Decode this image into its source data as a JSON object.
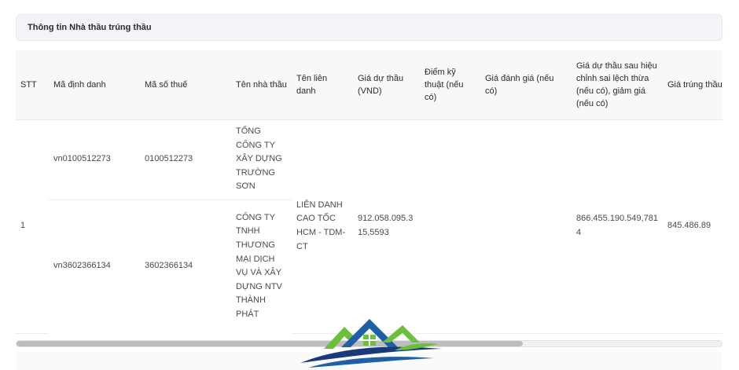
{
  "panel": {
    "title": "Thông tin Nhà thầu trúng thầu"
  },
  "table": {
    "headers": {
      "stt": "STT",
      "ma_dinh_danh": "Mã định danh",
      "ma_so_thue": "Mã số thuế",
      "ten_nha_thau": "Tên nhà thầu",
      "ten_lien_danh": "Tên liên danh",
      "gia_du_thau": "Giá dự thầu (VND)",
      "diem_ky_thuat": "Điểm kỹ thuật (nếu có)",
      "gia_danh_gia": "Giá đánh giá (nếu có)",
      "gia_sau_hieu_chinh": "Giá dự thầu sau hiệu chỉnh sai lệch thừa (nếu có), giảm giá (nếu có)",
      "gia_trung_thau": "Giá trúng thầu (VND)"
    },
    "group": {
      "stt": "1",
      "ten_lien_danh": "LIÊN DANH CAO TỐC HCM - TDM-CT",
      "gia_du_thau": "912.058.095.315,5593",
      "diem_ky_thuat": "",
      "gia_danh_gia": "",
      "gia_sau_hieu_chinh": "866.455.190.549,7814",
      "gia_trung_thau": "845.486.89"
    },
    "rows": [
      {
        "ma_dinh_danh": "vn0100512273",
        "ma_so_thue": "0100512273",
        "ten_nha_thau": "TỔNG CÔNG TY XÂY DỰNG TRƯỜNG SƠN"
      },
      {
        "ma_dinh_danh": "vn3602366134",
        "ma_so_thue": "3602366134",
        "ten_nha_thau": "CÔNG TY TNHH THƯƠNG MẠI DỊCH VỤ VÀ XÂY DỰNG NTV THÀNH PHÁT"
      }
    ]
  },
  "scroll": {
    "horizontal_position": 0.0
  },
  "logo": {
    "icon": "house-roof-logo-icon",
    "colors": {
      "blue": "#1f5fa8",
      "green": "#6cbf3b",
      "navy": "#163a7a"
    }
  }
}
